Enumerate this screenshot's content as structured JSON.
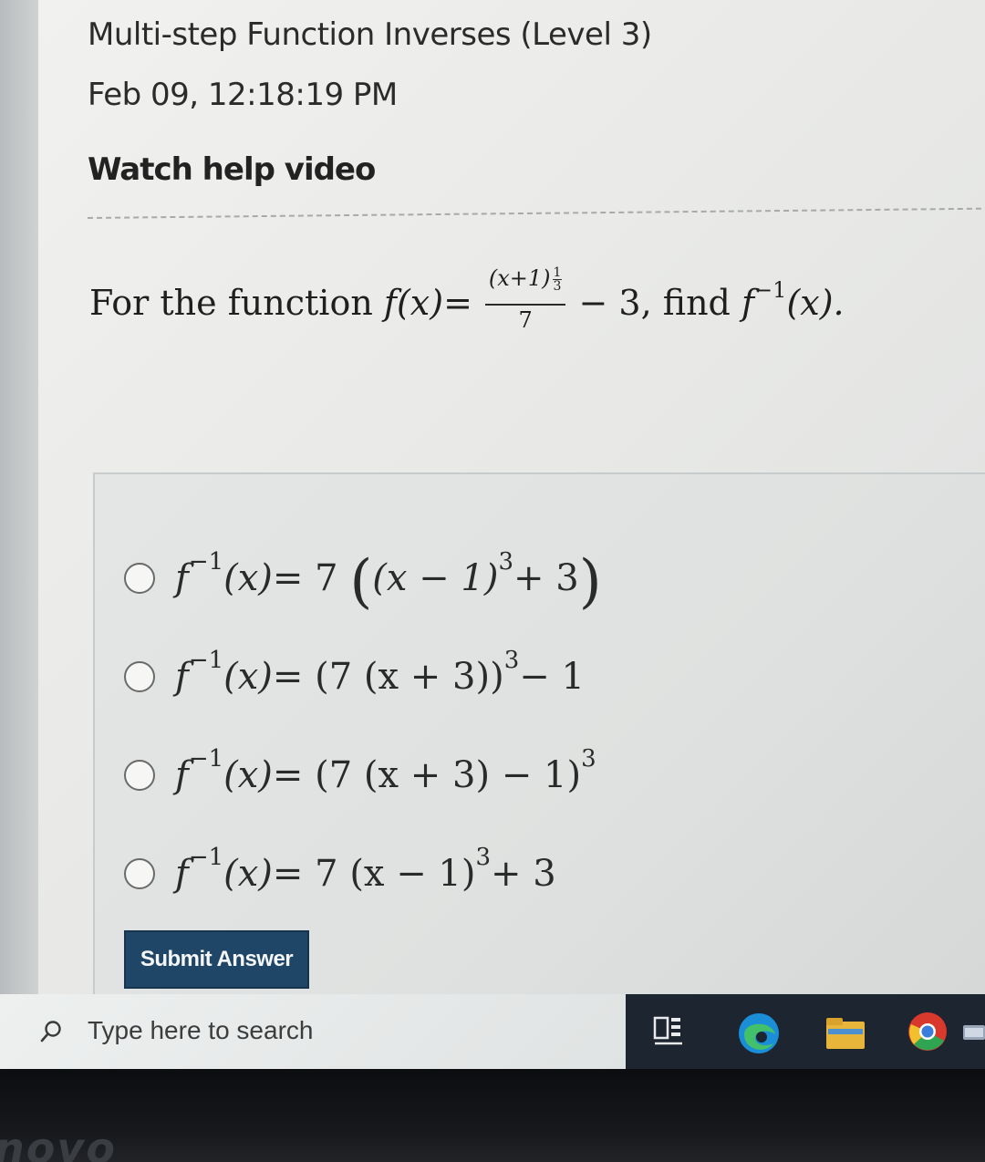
{
  "header": {
    "title": "Multi-step Function Inverses (Level 3)",
    "timestamp": "Feb 09, 12:18:19 PM",
    "help_link": "Watch help video"
  },
  "question": {
    "prefix": "For the function ",
    "fn": "f",
    "arg": "(x)",
    "equals": " = ",
    "numerator_base": "(x+1)",
    "exp_num": "1",
    "exp_den": "3",
    "denominator": "7",
    "tail": " − 3, find ",
    "inverse_fn": "f",
    "inverse_sup": "−1",
    "inverse_arg": "(x).",
    "spoken": "For the function f(x) = (x+1)^(1/3)/7 − 3, find f^(−1)(x)."
  },
  "choices": [
    {
      "lhs": "f",
      "sup": "−1",
      "arg": "(x)",
      "rhs_a": " = 7",
      "rhs_b": "(x − 1)",
      "rhs_c": "3",
      "rhs_d": " + 3",
      "spoken": "f^(−1)(x) = 7((x − 1)^3 + 3)"
    },
    {
      "lhs": "f",
      "sup": "−1",
      "arg": "(x)",
      "rhs_a": " = (7 (x + 3))",
      "rhs_c": "3",
      "rhs_d": " − 1",
      "spoken": "f^(−1)(x) = (7(x + 3))^3 − 1"
    },
    {
      "lhs": "f",
      "sup": "−1",
      "arg": "(x)",
      "rhs_a": " = (7 (x + 3) − 1)",
      "rhs_c": "3",
      "rhs_d": "",
      "spoken": "f^(−1)(x) = (7(x + 3) − 1)^3"
    },
    {
      "lhs": "f",
      "sup": "−1",
      "arg": "(x)",
      "rhs_a": " = 7 (x − 1)",
      "rhs_c": "3",
      "rhs_d": " + 3",
      "spoken": "f^(−1)(x) = 7(x − 1)^3 + 3"
    }
  ],
  "submit_label": "Submit Answer",
  "taskbar": {
    "search_placeholder": "Type here to search",
    "icons": [
      "search-icon",
      "task-view-icon",
      "edge-icon",
      "file-explorer-icon",
      "chrome-icon"
    ]
  },
  "bezel": {
    "brand": "novo"
  },
  "colors": {
    "submit_bg": "#1f4567",
    "taskbar_bg": "#1c2530",
    "page_bg": "#eeeeec"
  }
}
